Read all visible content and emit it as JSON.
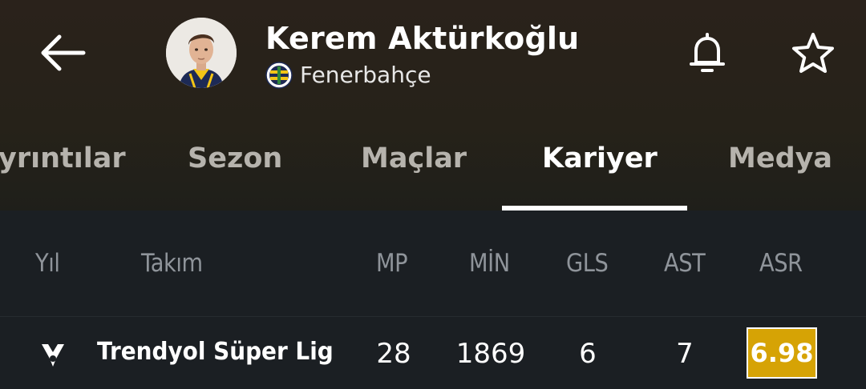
{
  "header": {
    "player_name": "Kerem Aktürkoğlu",
    "club_name": "Fenerbahçe",
    "icons": {
      "back": "arrow-left-icon",
      "notifications": "bell-icon",
      "favorite": "star-icon"
    }
  },
  "tabs": [
    {
      "label": "Ayrıntılar",
      "visible_text": "yrıntılar",
      "active": false
    },
    {
      "label": "Sezon",
      "active": false
    },
    {
      "label": "Maçlar",
      "active": false
    },
    {
      "label": "Kariyer",
      "active": true
    },
    {
      "label": "Medya",
      "active": false
    }
  ],
  "table": {
    "headers": [
      "Yıl",
      "Takım",
      "MP",
      "MİN",
      "GLS",
      "AST",
      "ASR"
    ],
    "rows": [
      {
        "league": "Trendyol Süper Lig",
        "mp": "28",
        "min": "1869",
        "gls": "6",
        "ast": "7",
        "asr": "6.98"
      }
    ]
  },
  "colors": {
    "background": "#1b1f23",
    "header_gradient_top": "#2a221b",
    "tab_active": "#ffffff",
    "tab_inactive": "#b6b3ad",
    "table_header_text": "#8f949a",
    "rating_badge": "#d6a305"
  }
}
